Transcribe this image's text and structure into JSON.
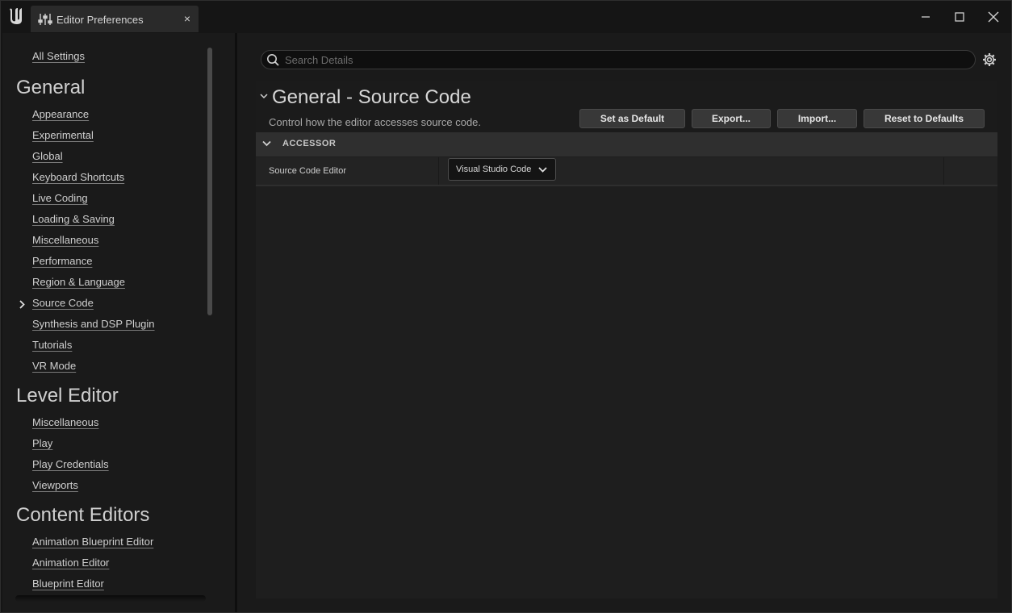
{
  "window": {
    "tab_title": "Editor Preferences",
    "tab_close": "×"
  },
  "sidebar": {
    "all_settings": "All Settings",
    "sections": [
      {
        "title": "General",
        "items": [
          "Appearance",
          "Experimental",
          "Global",
          "Keyboard Shortcuts",
          "Live Coding",
          "Loading & Saving",
          "Miscellaneous",
          "Performance",
          "Region & Language",
          "Source Code",
          "Synthesis and DSP Plugin",
          "Tutorials",
          "VR Mode"
        ]
      },
      {
        "title": "Level Editor",
        "items": [
          "Miscellaneous",
          "Play",
          "Play Credentials",
          "Viewports"
        ]
      },
      {
        "title": "Content Editors",
        "items": [
          "Animation Blueprint Editor",
          "Animation Editor",
          "Blueprint Editor"
        ]
      }
    ],
    "active_item": "Source Code"
  },
  "search": {
    "placeholder": "Search Details",
    "value": ""
  },
  "category": {
    "title": "General - Source Code",
    "description": "Control how the editor accesses source code.",
    "buttons": {
      "set_default": "Set as Default",
      "export": "Export...",
      "import": "Import...",
      "reset": "Reset to Defaults"
    }
  },
  "group": {
    "label": "ACCESSOR"
  },
  "property": {
    "name": "Source Code Editor",
    "value": "Visual Studio Code"
  },
  "icons": {
    "logo": "unreal-logo-icon",
    "tab": "settings-sliders-icon",
    "minimize": "minimize-icon",
    "maximize": "maximize-icon",
    "close": "close-icon",
    "search": "search-icon",
    "gear": "gear-icon"
  },
  "colors": {
    "background": "#151515",
    "panel": "#1a1a1a",
    "group_header": "#2f2f2f",
    "button": "#383838"
  }
}
